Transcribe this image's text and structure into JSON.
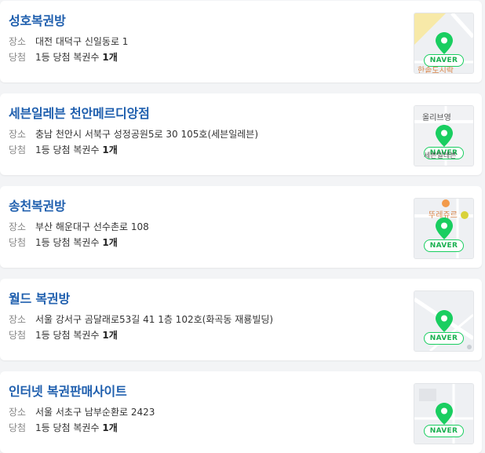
{
  "labels": {
    "location": "장소",
    "win": "당첨"
  },
  "map_badge": "NAVER",
  "accent": "#1f5fae",
  "pin_color": "#19ce60",
  "shops": [
    {
      "name": "성호복권방",
      "address": "대전 대덕구 신일동로 1",
      "prize": "1등 당첨 복권수",
      "count": "1개",
      "map_label": "한솥도시락"
    },
    {
      "name": "세븐일레븐 천안메르디앙점",
      "address": "충남 천안시 서북구 성정공원5로 30 105호(세븐일레븐)",
      "prize": "1등 당첨 복권수",
      "count": "1개",
      "map_label": "올리브영",
      "map_label2": "세븐일레븐"
    },
    {
      "name": "송천복권방",
      "address": "부산 해운대구 선수촌로 108",
      "prize": "1등 당첨 복권수",
      "count": "1개",
      "map_label": "뚜레쥬르"
    },
    {
      "name": "월드 복권방",
      "address": "서울 강서구 곰달래로53길 41 1층 102호(화곡동 재룡빌딩)",
      "prize": "1등 당첨 복권수",
      "count": "1개"
    },
    {
      "name": "인터넷 복권판매사이트",
      "address": "서울 서초구 남부순환로 2423",
      "prize": "1등 당첨 복권수",
      "count": "1개"
    }
  ]
}
